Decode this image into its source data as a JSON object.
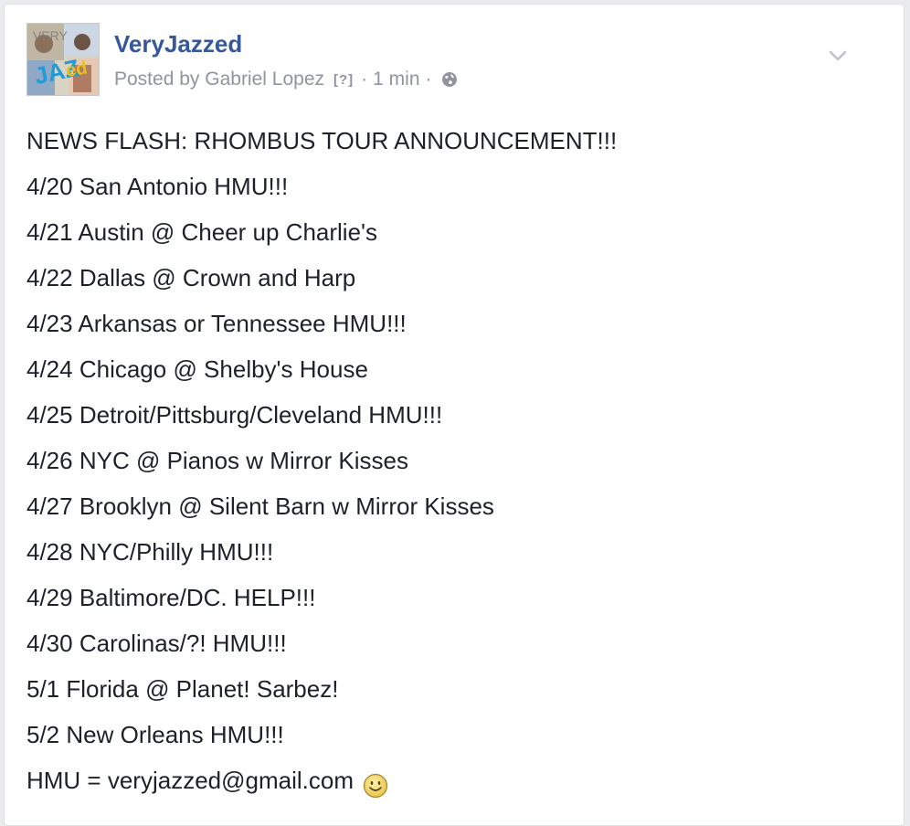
{
  "post": {
    "page_name": "VeryJazzed",
    "avatar_text": "JAZed",
    "posted_by_prefix": "Posted by",
    "author": "Gabriel Lopez",
    "help_marker": "[?]",
    "separator": "·",
    "time": "1 min",
    "privacy_icon": "globe-icon",
    "menu_icon": "chevron-down-icon"
  },
  "content": {
    "lines": [
      "NEWS FLASH: RHOMBUS TOUR ANNOUNCEMENT!!!",
      "4/20 San Antonio HMU!!!",
      "4/21 Austin @ Cheer up Charlie's",
      "4/22 Dallas @ Crown and Harp",
      "4/23 Arkansas or Tennessee HMU!!!",
      "4/24 Chicago @ Shelby's House",
      "4/25 Detroit/Pittsburg/Cleveland HMU!!!",
      "4/26 NYC @ Pianos w Mirror Kisses",
      "4/27 Brooklyn @ Silent Barn w Mirror Kisses",
      "4/28 NYC/Philly HMU!!!",
      "4/29 Baltimore/DC. HELP!!!",
      "4/30 Carolinas/?! HMU!!!",
      "5/1 Florida @ Planet! Sarbez!",
      "5/2 New Orleans HMU!!!",
      "HMU = veryjazzed@gmail.com"
    ],
    "emoji": "smile-emoji-icon"
  },
  "colors": {
    "link_blue": "#365899",
    "meta_gray": "#90949c",
    "text": "#1d2129"
  }
}
